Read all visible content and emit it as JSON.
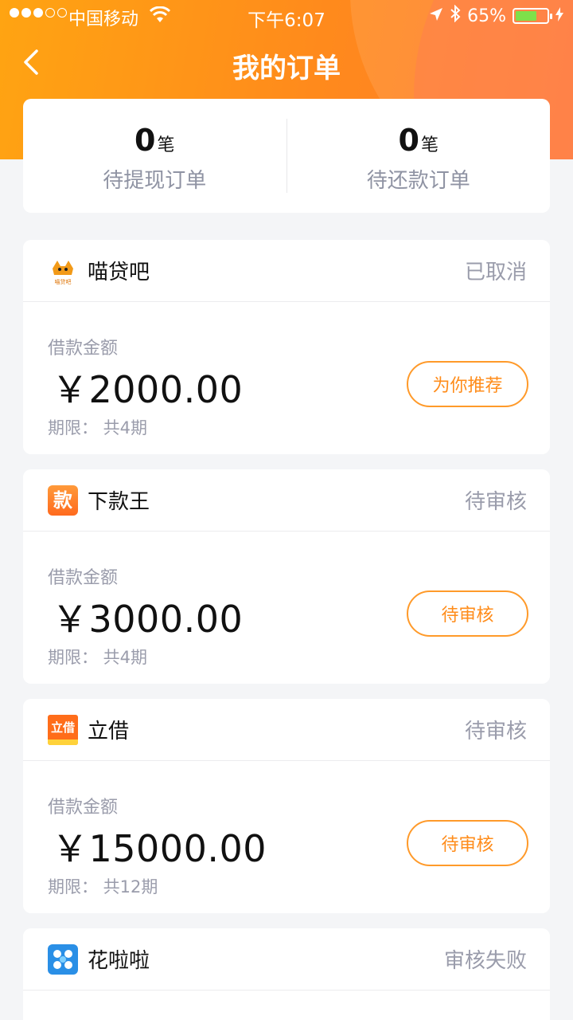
{
  "status_bar": {
    "carrier": "中国移动",
    "time": "下午6:07",
    "battery": "65%"
  },
  "nav": {
    "title": "我的订单"
  },
  "summary": [
    {
      "count": "0",
      "unit": "笔",
      "label": "待提现订单"
    },
    {
      "count": "0",
      "unit": "笔",
      "label": "待还款订单"
    }
  ],
  "orders": [
    {
      "merchant": "喵贷吧",
      "logo_text": "喵贷吧",
      "status": "已取消",
      "amount_label": "借款金额",
      "amount": "￥2000.00",
      "term": "期限：  共4期",
      "action": "为你推荐"
    },
    {
      "merchant": "下款王",
      "logo_text": "款",
      "status": "待审核",
      "amount_label": "借款金额",
      "amount": "￥3000.00",
      "term": "期限：  共4期",
      "action": "待审核"
    },
    {
      "merchant": "立借",
      "logo_text": "立借",
      "status": "待审核",
      "amount_label": "借款金额",
      "amount": "￥15000.00",
      "term": "期限：  共12期",
      "action": "待审核"
    },
    {
      "merchant": "花啦啦",
      "status": "审核失败"
    }
  ],
  "colors": {
    "accent": "#ff8c1a",
    "header_start": "#ffa412",
    "header_end": "#ff7a2c"
  }
}
